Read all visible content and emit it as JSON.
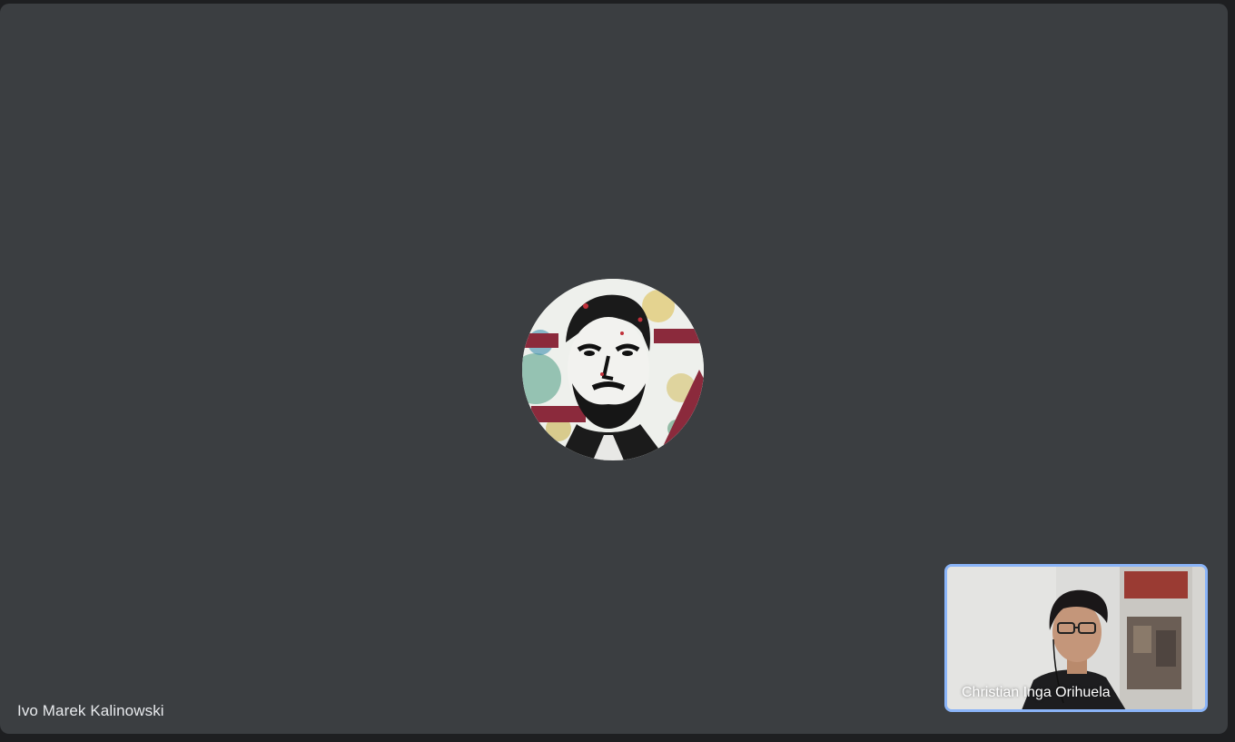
{
  "main_participant": {
    "name": "Ivo Marek Kalinowski",
    "avatar_icon": "profile-portrait-avatar"
  },
  "self_view": {
    "name": "Christian Inga Orihuela",
    "highlight_color": "#8ab4f8"
  },
  "colors": {
    "stage_background": "#3b3e41",
    "page_background": "#1e1f21"
  }
}
